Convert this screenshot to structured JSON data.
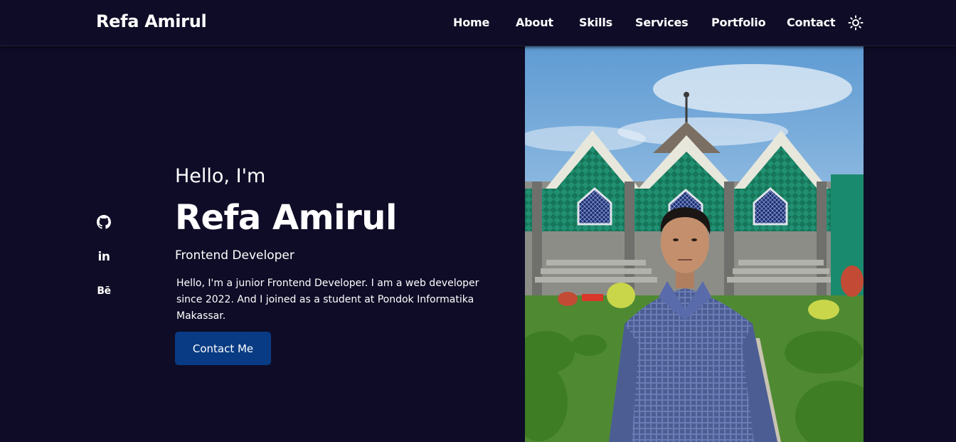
{
  "header": {
    "logo": "Refa Amirul",
    "nav": [
      {
        "label": "Home",
        "name": "nav-home"
      },
      {
        "label": "About",
        "name": "nav-about"
      },
      {
        "label": "Skills",
        "name": "nav-skills"
      },
      {
        "label": "Services",
        "name": "nav-services"
      },
      {
        "label": "Portfolio",
        "name": "nav-portfolio"
      },
      {
        "label": "Contact",
        "name": "nav-contact"
      }
    ],
    "theme_icon": "sun-icon"
  },
  "social": [
    {
      "icon": "github-icon"
    },
    {
      "icon": "linkedin-icon",
      "glyph": "in"
    },
    {
      "icon": "behance-icon",
      "glyph": "Bē"
    }
  ],
  "hero": {
    "greeting": "Hello, I'm",
    "name": "Refa Amirul",
    "role": "Frontend Developer",
    "bio": "Hello, I'm a junior Frontend Developer. I am a web developer since 2022. And I joined as a student at Pondok Informatika Makassar.",
    "cta": "Contact Me"
  },
  "photo": {
    "description_icon": "profile-photo"
  },
  "colors": {
    "background": "#0f0c27",
    "button": "#083b84",
    "text": "#ffffff"
  }
}
